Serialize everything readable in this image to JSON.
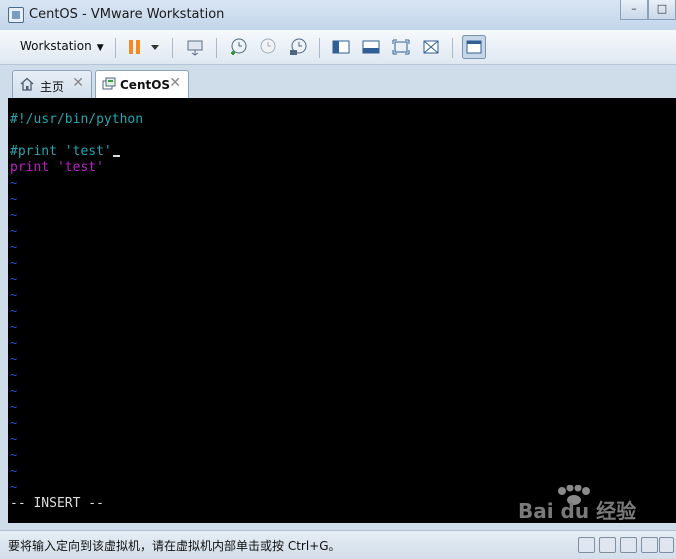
{
  "window": {
    "title": "CentOS - VMware Workstation"
  },
  "toolbar": {
    "menu_label": "Workstation"
  },
  "tabs": [
    {
      "label": "主页",
      "icon": "home-icon",
      "close": "✕"
    },
    {
      "label": "CentOS",
      "icon": "vm-icon",
      "close": "✕"
    }
  ],
  "terminal": {
    "line1": "#!/usr/bin/python",
    "line3_comment": "#print 'test'",
    "line4_keyword": "print",
    "line4_string": "'test'",
    "tilde": "~",
    "mode": "-- INSERT --"
  },
  "statusbar": {
    "message": "要将输入定向到该虚拟机，请在虚拟机内部单击或按 Ctrl+G。"
  },
  "watermark": {
    "text": "Bai du 经验"
  },
  "colors": {
    "console_bg": "#000000",
    "teal": "#1fa6b1",
    "magenta": "#c11bc9",
    "tilde_blue": "#1e56d8"
  }
}
